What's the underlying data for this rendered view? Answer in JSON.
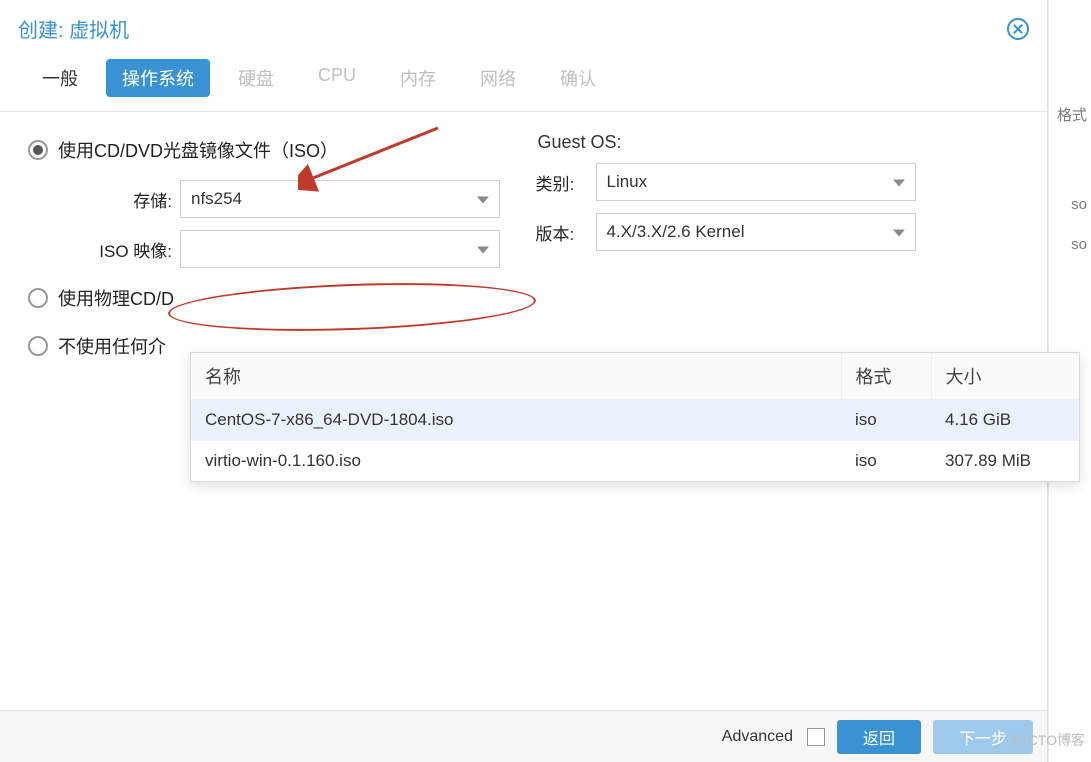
{
  "header": {
    "title": "创建: 虚拟机"
  },
  "tabs": {
    "general": "一般",
    "os": "操作系统",
    "disk": "硬盘",
    "cpu": "CPU",
    "memory": "内存",
    "network": "网络",
    "confirm": "确认"
  },
  "radios": {
    "use_iso": "使用CD/DVD光盘镜像文件（ISO）",
    "use_physical": "使用物理CD/D",
    "use_none": "不使用任何介"
  },
  "fields": {
    "storage_label": "存储:",
    "storage_value": "nfs254",
    "iso_label": "ISO 映像:",
    "iso_value": ""
  },
  "guest": {
    "title": "Guest OS:",
    "type_label": "类别:",
    "type_value": "Linux",
    "version_label": "版本:",
    "version_value": "4.X/3.X/2.6 Kernel"
  },
  "dropdown": {
    "cols": {
      "name": "名称",
      "format": "格式",
      "size": "大小"
    },
    "rows": [
      {
        "name": "CentOS-7-x86_64-DVD-1804.iso",
        "format": "iso",
        "size": "4.16 GiB"
      },
      {
        "name": "virtio-win-0.1.160.iso",
        "format": "iso",
        "size": "307.89 MiB"
      }
    ]
  },
  "footer": {
    "advanced": "Advanced",
    "back": "返回",
    "next": "下一步"
  },
  "bg": {
    "t1": "格式",
    "t2": "so",
    "t3": "so"
  },
  "watermark": "51CTO博客"
}
